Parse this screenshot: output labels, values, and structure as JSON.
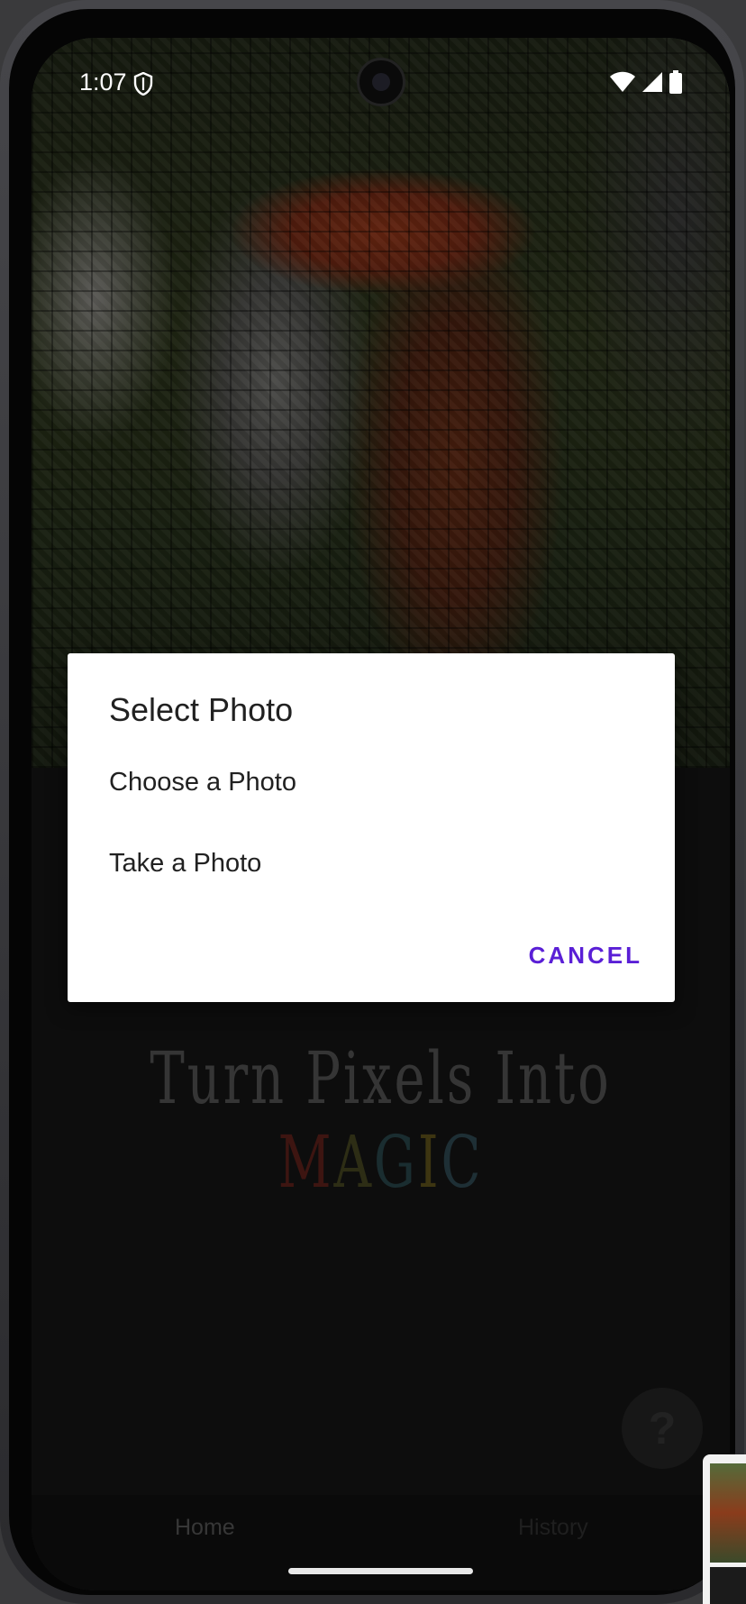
{
  "status_bar": {
    "time": "1:07"
  },
  "tagline": {
    "prefix": "Turn Pixels Into ",
    "magic_letters": [
      "M",
      "A",
      "G",
      "I",
      "C"
    ]
  },
  "dialog": {
    "title": "Select Photo",
    "options": [
      "Choose a Photo",
      "Take a Photo"
    ],
    "cancel_label": "CANCEL"
  },
  "help_button": {
    "label": "?"
  },
  "bottom_nav": {
    "items": [
      "Home",
      "History"
    ]
  },
  "colors": {
    "dialog_accent": "#5a1fd6",
    "scrim": "#000000",
    "dialog_bg": "#ffffff"
  }
}
